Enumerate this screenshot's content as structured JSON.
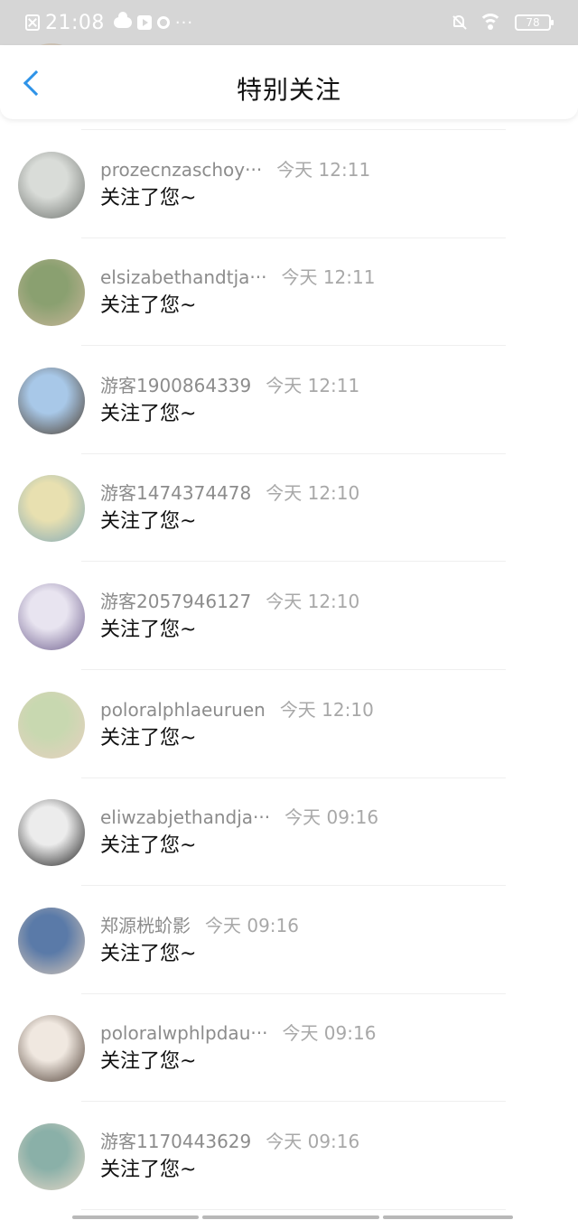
{
  "status_bar": {
    "time": "21:08",
    "dots": "···",
    "battery": "78"
  },
  "header": {
    "title": "特别关注"
  },
  "items": [
    {
      "name": "",
      "time": "",
      "message": "关注了您~",
      "avatar_colors": [
        "#d8cfc2",
        "#a39382"
      ]
    },
    {
      "name": "prozecnzaschoy···",
      "time": "今天 12:11",
      "message": "关注了您~",
      "avatar_colors": [
        "#d9dcd8",
        "#6a6e6a"
      ]
    },
    {
      "name": "elsizabethandtja···",
      "time": "今天 12:11",
      "message": "关注了您~",
      "avatar_colors": [
        "#8aa070",
        "#c9b69a"
      ]
    },
    {
      "name": "游客1900864339",
      "time": "今天 12:11",
      "message": "关注了您~",
      "avatar_colors": [
        "#a8c8e8",
        "#4a3a2a"
      ]
    },
    {
      "name": "游客1474374478",
      "time": "今天 12:10",
      "message": "关注了您~",
      "avatar_colors": [
        "#e8e0b0",
        "#7fa8b8"
      ]
    },
    {
      "name": "游客2057946127",
      "time": "今天 12:10",
      "message": "关注了您~",
      "avatar_colors": [
        "#e8e4f0",
        "#6a5a8a"
      ]
    },
    {
      "name": "poloralphlaeuruen",
      "time": "今天 12:10",
      "message": "关注了您~",
      "avatar_colors": [
        "#c8d8b0",
        "#e8d0c0"
      ]
    },
    {
      "name": "eliwzabjethandja···",
      "time": "今天 09:16",
      "message": "关注了您~",
      "avatar_colors": [
        "#ececec",
        "#1a1a1a"
      ]
    },
    {
      "name": "郑源桄蚧影",
      "time": "今天 09:16",
      "message": "关注了您~",
      "avatar_colors": [
        "#5a7aa8",
        "#d8c8b8"
      ]
    },
    {
      "name": "poloralwphlpdau···",
      "time": "今天 09:16",
      "message": "关注了您~",
      "avatar_colors": [
        "#f0e8e0",
        "#4a3a30"
      ]
    },
    {
      "name": "游客1170443629",
      "time": "今天 09:16",
      "message": "关注了您~",
      "avatar_colors": [
        "#8ab0a8",
        "#e8d8c8"
      ]
    }
  ]
}
